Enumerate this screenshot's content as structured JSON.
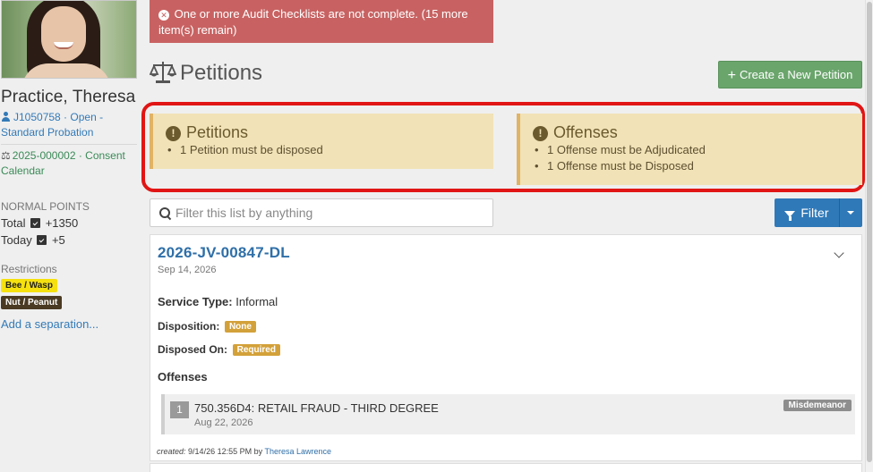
{
  "sidebar": {
    "name": "Practice, Theresa",
    "case_link": "J1050758 · Open - Standard Probation",
    "petition_link": "2025-000002 · Consent Calendar",
    "points_title": "NORMAL POINTS",
    "total_label": "Total",
    "total_value": "+1350",
    "today_label": "Today",
    "today_value": "+5",
    "restrictions_title": "Restrictions",
    "restrictions": [
      "Bee / Wasp",
      "Nut / Peanut"
    ],
    "add_separation": "Add a separation..."
  },
  "alert": {
    "text": "One or more Audit Checklists are not complete. (15 more item(s) remain)"
  },
  "header": {
    "title": "Petitions",
    "create_button": "Create a New Petition"
  },
  "warnings": {
    "petitions": {
      "title": "Petitions",
      "items": [
        "1 Petition must be disposed"
      ]
    },
    "offenses": {
      "title": "Offenses",
      "items": [
        "1 Offense must be Adjudicated",
        "1 Offense must be Disposed"
      ]
    }
  },
  "filter": {
    "placeholder": "Filter this list by anything",
    "button": "Filter"
  },
  "petition": {
    "number": "2026-JV-00847-DL",
    "date": "Sep 14, 2026",
    "service_type_label": "Service Type:",
    "service_type_value": "Informal",
    "disposition_label": "Disposition:",
    "disposition_value": "None",
    "disposed_on_label": "Disposed On:",
    "disposed_on_value": "Required",
    "offenses_header": "Offenses",
    "offenses": [
      {
        "num": "1",
        "title": "750.356D4: RETAIL FRAUD - THIRD DEGREE",
        "date": "Aug 22, 2026",
        "class": "Misdemeanor"
      }
    ],
    "created_label": "created:",
    "created_value": "9/14/26 12:55 PM by",
    "created_by": "Theresa Lawrence"
  },
  "colors": {
    "alert": "#c86262",
    "warning_bg": "#f1e2b7",
    "highlight": "#e11515",
    "primary": "#2f79b8",
    "success": "#6aa56c"
  }
}
